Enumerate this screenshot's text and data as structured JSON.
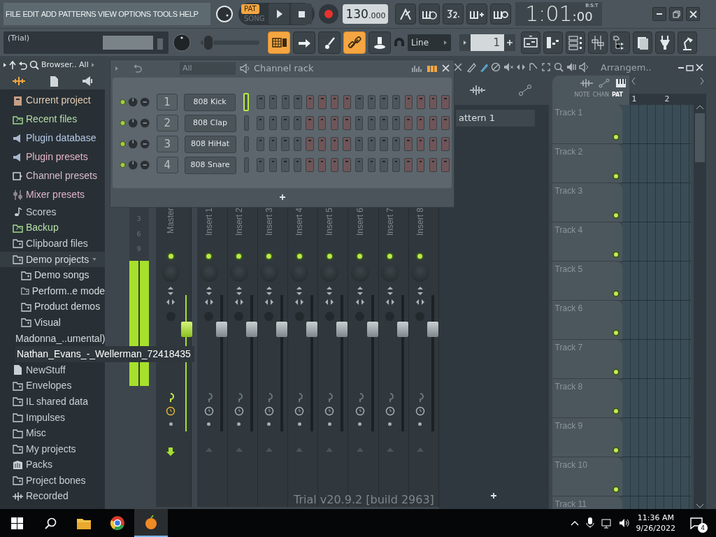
{
  "menu": [
    "FILE",
    "EDIT",
    "ADD",
    "PATTERNS",
    "VIEW",
    "OPTIONS",
    "TOOLS",
    "HELP"
  ],
  "transport": {
    "modes": [
      {
        "label": "PAT",
        "selected": true
      },
      {
        "label": "SONG",
        "selected": false
      }
    ],
    "tempo": "130",
    "tempo_fraction": ".000"
  },
  "time": {
    "main": "1:01",
    "sub": ":00",
    "unit": "B:S:T"
  },
  "hint": "(Trial)",
  "master_pitch": {
    "level": 0.05
  },
  "toggles": [
    {
      "kind": "grid",
      "on": true
    },
    {
      "kind": "arrow",
      "on": false
    },
    {
      "kind": "brush",
      "on": false
    },
    {
      "kind": "link",
      "on": true
    },
    {
      "kind": "stamp",
      "on": false
    }
  ],
  "snap": "Line",
  "pattern_number": "1",
  "browser": {
    "title": "Browser.. All",
    "items": [
      {
        "label": "Current project",
        "kind": "project",
        "color": "#e3cbb4",
        "expanded": false
      },
      {
        "label": "Recent files",
        "kind": "recent",
        "color": "#b5dca8",
        "expanded": false
      },
      {
        "label": "Plugin database",
        "kind": "plugin",
        "color": "#b4c8e6",
        "expanded": false
      },
      {
        "label": "Plugin presets",
        "kind": "plugin",
        "color": "#e6b4c8",
        "expanded": false
      },
      {
        "label": "Channel presets",
        "kind": "channel",
        "color": "#d8bccc",
        "expanded": false
      },
      {
        "label": "Mixer presets",
        "kind": "mixer",
        "color": "#e0b4cc",
        "expanded": false
      },
      {
        "label": "Scores",
        "kind": "note",
        "color": "#c4ccd0",
        "expanded": false
      },
      {
        "label": "Backup",
        "kind": "recent",
        "color": "#b5e0a8",
        "expanded": false
      },
      {
        "label": "Clipboard files",
        "kind": "folder",
        "color": "#c8d0d4",
        "expanded": false
      },
      {
        "label": "Demo projects",
        "kind": "folder",
        "color": "#d4dce0",
        "expanded": true,
        "children": [
          {
            "label": "Demo songs",
            "kind": "folder",
            "color": "#d4dce0"
          },
          {
            "label": "Perform..e mode",
            "kind": "folder",
            "color": "#d4dce0"
          },
          {
            "label": "Product demos",
            "kind": "folder",
            "color": "#d4dce0"
          },
          {
            "label": "Visual",
            "kind": "folder",
            "color": "#d4dce0"
          }
        ]
      },
      {
        "label": "Madonna_..umental)",
        "kind": "mp3",
        "color": "#d4dce0",
        "expanded": false
      },
      {
        "label": "Nathan_Evans_-_Wellerman_72418435",
        "kind": "mp3",
        "color": "#ffffff",
        "expanded": false
      },
      {
        "label": "NewStuff",
        "kind": "file",
        "color": "#c8d0d4",
        "expanded": false
      },
      {
        "label": "Envelopes",
        "kind": "folder",
        "color": "#c8d0d4",
        "expanded": false
      },
      {
        "label": "IL shared data",
        "kind": "folder",
        "color": "#c8d0d4",
        "expanded": false
      },
      {
        "label": "Impulses",
        "kind": "plainfolder",
        "color": "#c8d0d4",
        "expanded": false
      },
      {
        "label": "Misc",
        "kind": "plainfolder",
        "color": "#c8d0d4",
        "expanded": false
      },
      {
        "label": "My projects",
        "kind": "folder",
        "color": "#c8d0d4",
        "expanded": false
      },
      {
        "label": "Packs",
        "kind": "packs",
        "color": "#c8d0d4",
        "expanded": false
      },
      {
        "label": "Project bones",
        "kind": "folder",
        "color": "#c8d0d4",
        "expanded": false
      },
      {
        "label": "Recorded",
        "kind": "wave",
        "color": "#c8d0d4",
        "expanded": false
      }
    ]
  },
  "channel_rack": {
    "title": "Channel rack",
    "filter": "All",
    "channels": [
      {
        "number": "1",
        "name": "808 Kick",
        "selected": true
      },
      {
        "number": "2",
        "name": "808 Clap",
        "selected": false
      },
      {
        "number": "3",
        "name": "808 HiHat",
        "selected": false
      },
      {
        "number": "4",
        "name": "808 Snare",
        "selected": false
      }
    ]
  },
  "mixer": {
    "meter_scale": [
      "3",
      "6",
      "9"
    ],
    "master_meter": {
      "level": 0.97
    },
    "tracks": [
      {
        "name": "Master",
        "level": 0.78
      },
      {
        "name": "Insert 1",
        "level": 0.78
      },
      {
        "name": "Insert 2",
        "level": 0.78
      },
      {
        "name": "Insert 3",
        "level": 0.78
      },
      {
        "name": "Insert 4",
        "level": 0.78
      },
      {
        "name": "Insert 5",
        "level": 0.78
      },
      {
        "name": "Insert 6",
        "level": 0.78
      },
      {
        "name": "Insert 7",
        "level": 0.78
      },
      {
        "name": "Insert 8",
        "level": 0.78
      }
    ],
    "version": "Trial v20.9.2 [build 2963]"
  },
  "playlist": {
    "title": "Arrangem..",
    "patterns": [
      "attern 1"
    ],
    "tabs": [
      {
        "label": "NOTE",
        "selected": false
      },
      {
        "label": "CHAN",
        "selected": false
      },
      {
        "label": "PAT",
        "selected": true
      }
    ],
    "ruler": [
      "1",
      "2"
    ],
    "tracks": [
      "Track 1",
      "Track 2",
      "Track 3",
      "Track 4",
      "Track 5",
      "Track 6",
      "Track 7",
      "Track 8",
      "Track 9",
      "Track 10",
      "Track 11"
    ]
  },
  "taskbar": {
    "time": "11:36 AM",
    "date": "9/26/2022",
    "notifications": "4"
  }
}
